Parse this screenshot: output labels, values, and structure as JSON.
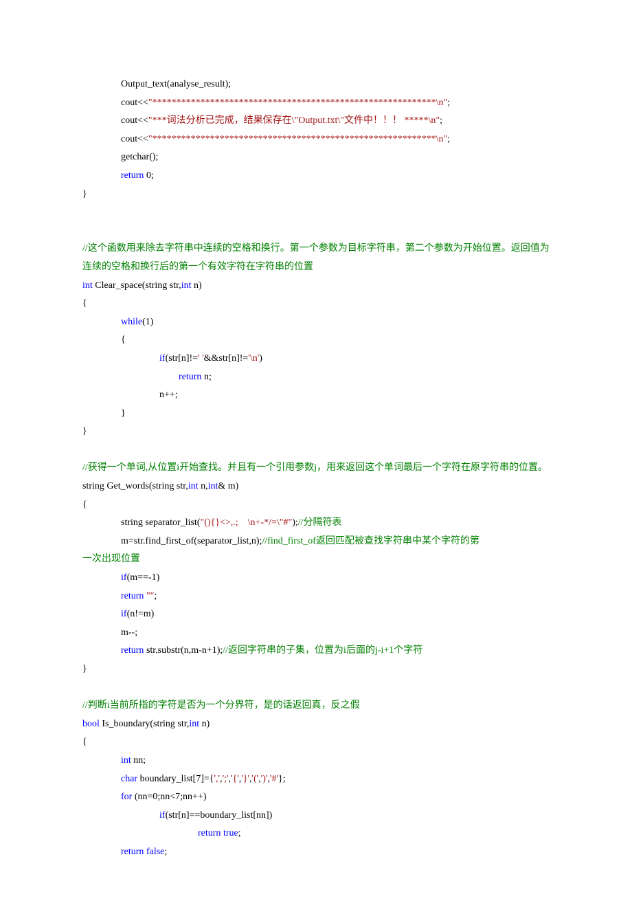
{
  "lines": [
    {
      "indent": 2,
      "spans": [
        {
          "c": "blk",
          "t": "Output_text(analyse_result);"
        }
      ]
    },
    {
      "indent": 2,
      "spans": [
        {
          "c": "blk",
          "t": "cout<<"
        },
        {
          "c": "mar",
          "t": "\"***********************************************************\\n\""
        },
        {
          "c": "blk",
          "t": ";"
        }
      ]
    },
    {
      "indent": 2,
      "spans": [
        {
          "c": "blk",
          "t": "cout<<"
        },
        {
          "c": "mar",
          "t": "\"***词法分析已完成，结果保存在\\\"Output.txt\\\"文件中！！！ *****\\n\""
        },
        {
          "c": "blk",
          "t": ";"
        }
      ]
    },
    {
      "indent": 2,
      "spans": [
        {
          "c": "blk",
          "t": "cout<<"
        },
        {
          "c": "mar",
          "t": "\"***********************************************************\\n\""
        },
        {
          "c": "blk",
          "t": ";"
        }
      ]
    },
    {
      "indent": 2,
      "spans": [
        {
          "c": "blk",
          "t": "getchar();"
        }
      ]
    },
    {
      "indent": 2,
      "spans": [
        {
          "c": "blu",
          "t": "return"
        },
        {
          "c": "blk",
          "t": " 0;"
        }
      ]
    },
    {
      "indent": 0,
      "spans": [
        {
          "c": "blk",
          "t": "}"
        }
      ]
    },
    {
      "indent": 0,
      "spans": [
        {
          "c": "blk",
          "t": ""
        }
      ]
    },
    {
      "indent": 0,
      "spans": [
        {
          "c": "blk",
          "t": ""
        }
      ]
    },
    {
      "indent": 0,
      "spans": [
        {
          "c": "grn",
          "t": "//这个函数用来除去字符串中连续的空格和换行。第一个参数为目标字符串，第二个参数为开始位置。返回值为连续的空格和换行后的第一个有效字符在字符串的位置"
        }
      ]
    },
    {
      "indent": 0,
      "spans": [
        {
          "c": "blu",
          "t": "int"
        },
        {
          "c": "blk",
          "t": " Clear_space(string str,"
        },
        {
          "c": "blu",
          "t": "int"
        },
        {
          "c": "blk",
          "t": " n)"
        }
      ]
    },
    {
      "indent": 0,
      "spans": [
        {
          "c": "blk",
          "t": "{"
        }
      ]
    },
    {
      "indent": 2,
      "spans": [
        {
          "c": "blu",
          "t": "while"
        },
        {
          "c": "blk",
          "t": "(1)"
        }
      ]
    },
    {
      "indent": 2,
      "spans": [
        {
          "c": "blk",
          "t": "{"
        }
      ]
    },
    {
      "indent": 4,
      "spans": [
        {
          "c": "blu",
          "t": "if"
        },
        {
          "c": "blk",
          "t": "(str[n]!="
        },
        {
          "c": "mar",
          "t": "' '"
        },
        {
          "c": "blk",
          "t": "&&str[n]!="
        },
        {
          "c": "mar",
          "t": "'\\n'"
        },
        {
          "c": "blk",
          "t": ")"
        }
      ]
    },
    {
      "indent": 5,
      "spans": [
        {
          "c": "blu",
          "t": "return"
        },
        {
          "c": "blk",
          "t": " n;"
        }
      ]
    },
    {
      "indent": 4,
      "spans": [
        {
          "c": "blk",
          "t": "n++;"
        }
      ]
    },
    {
      "indent": 2,
      "spans": [
        {
          "c": "blk",
          "t": "}"
        }
      ]
    },
    {
      "indent": 0,
      "spans": [
        {
          "c": "blk",
          "t": "}"
        }
      ]
    },
    {
      "indent": 0,
      "spans": [
        {
          "c": "blk",
          "t": ""
        }
      ]
    },
    {
      "indent": 0,
      "spans": [
        {
          "c": "grn",
          "t": "//获得一个单词,从位置i开始查找。并且有一个引用参数j，用来返回这个单词最后一个字符在原字符串的位置。"
        }
      ]
    },
    {
      "indent": 0,
      "spans": [
        {
          "c": "blk",
          "t": "string Get_words(string str,"
        },
        {
          "c": "blu",
          "t": "int"
        },
        {
          "c": "blk",
          "t": " n,"
        },
        {
          "c": "blu",
          "t": "int"
        },
        {
          "c": "blk",
          "t": "& m)"
        }
      ]
    },
    {
      "indent": 0,
      "spans": [
        {
          "c": "blk",
          "t": "{"
        }
      ]
    },
    {
      "indent": 2,
      "spans": [
        {
          "c": "blk",
          "t": "string separator_list("
        },
        {
          "c": "mar",
          "t": "\"(){}<>,.;    \\n+-*/=\\\"#\""
        },
        {
          "c": "blk",
          "t": ");"
        },
        {
          "c": "grn",
          "t": "//分隔符表"
        }
      ]
    },
    {
      "indent": 2,
      "spans": [
        {
          "c": "blk",
          "t": "m=str.find_first_of(separator_list,n);"
        },
        {
          "c": "grn",
          "t": "//find_first_of返回匹配被查找字符串中某个字符的第"
        }
      ]
    },
    {
      "indent": -1,
      "spans": [
        {
          "c": "grn",
          "t": "一次出现位置"
        }
      ]
    },
    {
      "indent": 2,
      "spans": [
        {
          "c": "blu",
          "t": "if"
        },
        {
          "c": "blk",
          "t": "(m==-1)"
        }
      ]
    },
    {
      "indent": 2,
      "spans": [
        {
          "c": "blu",
          "t": "return"
        },
        {
          "c": "blk",
          "t": " "
        },
        {
          "c": "mar",
          "t": "\"\""
        },
        {
          "c": "blk",
          "t": ";"
        }
      ]
    },
    {
      "indent": 2,
      "spans": [
        {
          "c": "blu",
          "t": "if"
        },
        {
          "c": "blk",
          "t": "(n!=m)"
        }
      ]
    },
    {
      "indent": 2,
      "spans": [
        {
          "c": "blk",
          "t": "m--;"
        }
      ]
    },
    {
      "indent": 2,
      "spans": [
        {
          "c": "blu",
          "t": "return"
        },
        {
          "c": "blk",
          "t": " str.substr(n,m-n+1);"
        },
        {
          "c": "grn",
          "t": "//返回字符串的子集，位置为i后面的j-i+1个字符"
        }
      ]
    },
    {
      "indent": 0,
      "spans": [
        {
          "c": "blk",
          "t": "}"
        }
      ]
    },
    {
      "indent": 0,
      "spans": [
        {
          "c": "blk",
          "t": ""
        }
      ]
    },
    {
      "indent": 0,
      "spans": [
        {
          "c": "grn",
          "t": "//判断i当前所指的字符是否为一个分界符，是的话返回真，反之假"
        }
      ]
    },
    {
      "indent": 0,
      "spans": [
        {
          "c": "blu",
          "t": "bool"
        },
        {
          "c": "blk",
          "t": " Is_boundary(string str,"
        },
        {
          "c": "blu",
          "t": "int"
        },
        {
          "c": "blk",
          "t": " n)"
        }
      ]
    },
    {
      "indent": 0,
      "spans": [
        {
          "c": "blk",
          "t": "{"
        }
      ]
    },
    {
      "indent": 2,
      "spans": [
        {
          "c": "blu",
          "t": "int"
        },
        {
          "c": "blk",
          "t": " nn;"
        }
      ]
    },
    {
      "indent": 2,
      "spans": [
        {
          "c": "blu",
          "t": "char"
        },
        {
          "c": "blk",
          "t": " boundary_list[7]={"
        },
        {
          "c": "mar",
          "t": "','"
        },
        {
          "c": "blk",
          "t": ","
        },
        {
          "c": "mar",
          "t": "';'"
        },
        {
          "c": "blk",
          "t": ","
        },
        {
          "c": "mar",
          "t": "'{'"
        },
        {
          "c": "blk",
          "t": ","
        },
        {
          "c": "mar",
          "t": "'}'"
        },
        {
          "c": "blk",
          "t": ","
        },
        {
          "c": "mar",
          "t": "'('"
        },
        {
          "c": "blk",
          "t": ","
        },
        {
          "c": "mar",
          "t": "')'"
        },
        {
          "c": "blk",
          "t": ","
        },
        {
          "c": "mar",
          "t": "'#'"
        },
        {
          "c": "blk",
          "t": "};"
        }
      ]
    },
    {
      "indent": 2,
      "spans": [
        {
          "c": "blu",
          "t": "for"
        },
        {
          "c": "blk",
          "t": " (nn=0;nn<7;nn++)"
        }
      ]
    },
    {
      "indent": 4,
      "spans": [
        {
          "c": "blu",
          "t": "if"
        },
        {
          "c": "blk",
          "t": "(str[n]==boundary_list[nn])"
        }
      ]
    },
    {
      "indent": 6,
      "spans": [
        {
          "c": "blu",
          "t": "return"
        },
        {
          "c": "blk",
          "t": " "
        },
        {
          "c": "blu",
          "t": "true"
        },
        {
          "c": "blk",
          "t": ";"
        }
      ]
    },
    {
      "indent": 2,
      "spans": [
        {
          "c": "blu",
          "t": "return"
        },
        {
          "c": "blk",
          "t": " "
        },
        {
          "c": "blu",
          "t": "false"
        },
        {
          "c": "blk",
          "t": ";"
        }
      ]
    }
  ]
}
